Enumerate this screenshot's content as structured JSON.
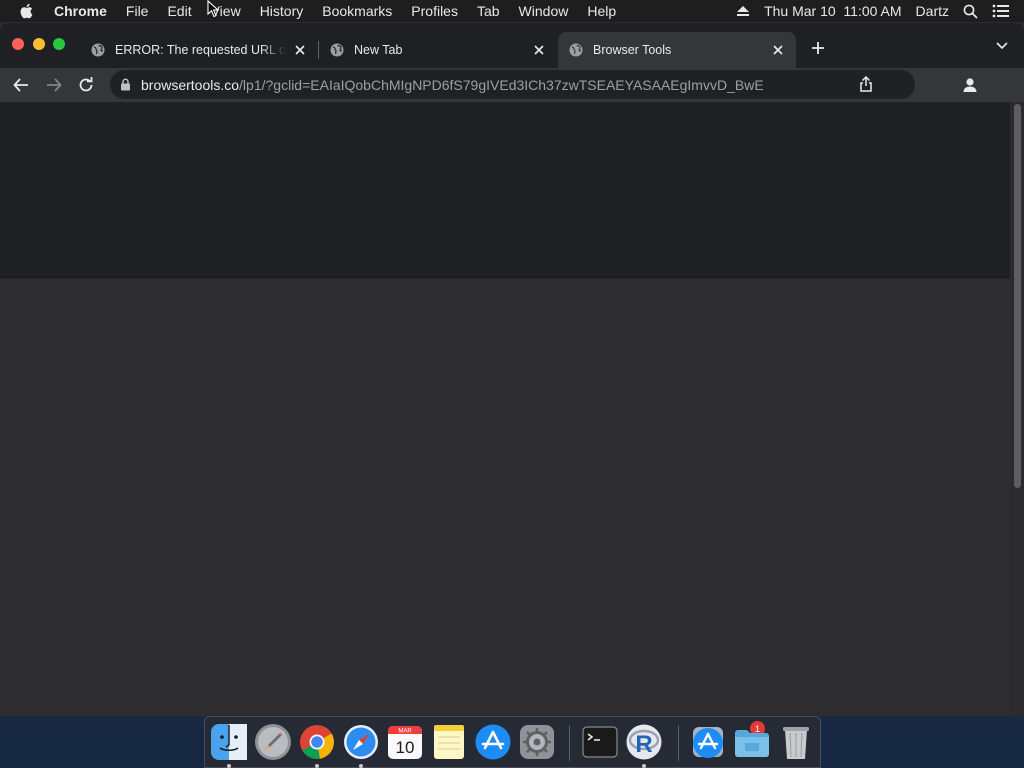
{
  "menubar": {
    "app_name": "Chrome",
    "items": [
      "File",
      "Edit",
      "View",
      "History",
      "Bookmarks",
      "Profiles",
      "Tab",
      "Window",
      "Help"
    ],
    "clock": "Thu Mar 10  11:00 AM",
    "user": "Dartz"
  },
  "tabs": [
    {
      "title": "ERROR: The requested URL could not be retrieved",
      "active": false,
      "icon": "globe-icon"
    },
    {
      "title": "New Tab",
      "active": false,
      "icon": "globe-icon"
    },
    {
      "title": "Browser Tools",
      "active": true,
      "icon": "globe-icon"
    }
  ],
  "address_bar": {
    "host": "browsertools.co",
    "path": "/lp1/?gclid=EAIaIQobChMIgNPD6fS79gIVEd3ICh37zwTSEAEYASAAEgImvvD_BwE"
  },
  "dock": {
    "calendar_month": "MAR",
    "calendar_day": "10",
    "settings_badge": "1",
    "apps": [
      "Finder",
      "Launchpad",
      "Google Chrome",
      "Safari",
      "Calendar",
      "Notes",
      "App Store",
      "System Preferences",
      "Terminal",
      "R",
      "App Store",
      "Downloads",
      "Trash"
    ]
  },
  "colors": {
    "tab_active": "#35363a",
    "window_bg": "#202124",
    "content_bg": "#2d2d2f"
  }
}
